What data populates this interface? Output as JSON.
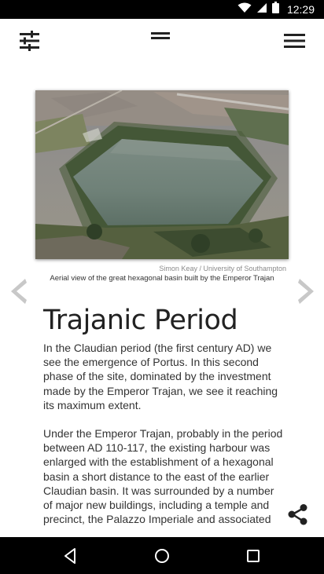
{
  "status_bar": {
    "time": "12:29",
    "icons": [
      "wifi-icon",
      "signal-icon",
      "battery-icon"
    ]
  },
  "top_bar": {
    "icons": [
      "filter-settings-icon",
      "drag-handle-icon",
      "hamburger-menu-icon"
    ]
  },
  "figure": {
    "credit": "Simon Keay / University of Southampton",
    "caption": "Aerial view of the great hexagonal basin built by the Emperor Trajan"
  },
  "article": {
    "title": "Trajanic Period",
    "paragraphs": [
      "In the Claudian period (the first century AD) we see the emergence of Portus. In this second phase of the site, dominated by the investment made by the Emperor Trajan, we see it reaching its maximum extent.",
      "Under the Emperor Trajan, probably in the period between AD 110-117, the existing harbour was enlarged with the establishment of a hexagonal basin a short distance to the east of the earlier Claudian basin. It was surrounded by a number of major new buildings, including a temple and precinct, the Palazzo Imperiale and associated"
    ]
  },
  "navigation": {
    "icons": [
      "chevron-left-icon",
      "chevron-right-icon",
      "share-icon"
    ]
  },
  "system_nav": {
    "icons": [
      "back-icon",
      "home-icon",
      "recents-icon"
    ]
  },
  "colors": {
    "status_bar": "#000000",
    "text": "#333333",
    "title": "#222222",
    "arrows": "#c8c8c8",
    "credit": "#8a8a8a"
  }
}
